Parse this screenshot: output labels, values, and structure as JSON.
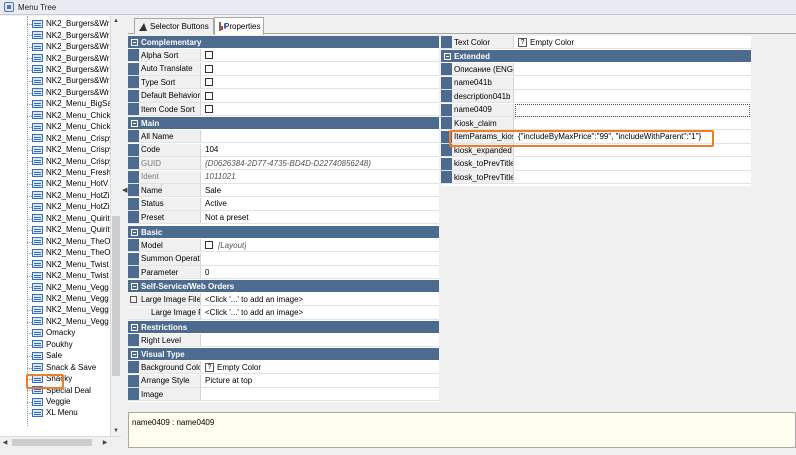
{
  "window": {
    "title": "Menu Tree"
  },
  "tree": {
    "items": [
      "NK2_Burgers&Wr",
      "NK2_Burgers&Wr",
      "NK2_Burgers&Wr",
      "NK2_Burgers&Wr",
      "NK2_Burgers&Wr",
      "NK2_Burgers&Wr",
      "NK2_Burgers&Wr",
      "NK2_Menu_BigSa",
      "NK2_Menu_Chick",
      "NK2_Menu_Chick",
      "NK2_Menu_Crispy",
      "NK2_Menu_Crispy",
      "NK2_Menu_Crispy",
      "NK2_Menu_Fresh",
      "NK2_Menu_HotV",
      "NK2_Menu_HotZi",
      "NK2_Menu_HotZi",
      "NK2_Menu_Quirit",
      "NK2_Menu_Quirit",
      "NK2_Menu_TheO",
      "NK2_Menu_TheO",
      "NK2_Menu_Twist",
      "NK2_Menu_Twist",
      "NK2_Menu_Vegg",
      "NK2_Menu_Vegg",
      "NK2_Menu_Vegg",
      "NK2_Menu_Vegg",
      "Omacky",
      "Poukhy",
      "Sale",
      "Snack & Save",
      "Snacky",
      "Special Deal",
      "Veggie",
      "XL Menu"
    ],
    "selected": "Sale"
  },
  "tabs": [
    {
      "label": "Selector Buttons"
    },
    {
      "label": "Properties"
    }
  ],
  "left_grid": {
    "complementary": {
      "title": "Complementary",
      "rows": [
        "Alpha Sort",
        "Auto Translate",
        "Type Sort",
        "Default Behavior",
        "Item Code Sort"
      ]
    },
    "main": {
      "title": "Main",
      "rows": [
        {
          "name": "All Name",
          "value": ""
        },
        {
          "name": "Code",
          "value": "104"
        },
        {
          "name": "GUID",
          "value": "{D0626384-2D77-4735-BD4D-D22740856248}"
        },
        {
          "name": "Ident",
          "value": "1011021"
        },
        {
          "name": "Name",
          "value": "Sale"
        },
        {
          "name": "Status",
          "value": "Active"
        },
        {
          "name": "Preset",
          "value": "Not a preset"
        }
      ]
    },
    "basic": {
      "title": "Basic",
      "rows": [
        {
          "name": "Model",
          "value": "[Layout]"
        },
        {
          "name": "Summon Operati",
          "value": ""
        },
        {
          "name": "Parameter",
          "value": "0"
        }
      ]
    },
    "self_service": {
      "title": "Self-Service/Web Orders",
      "rows": [
        {
          "name": "Large Image File",
          "value": "<Click '...' to add an image>"
        },
        {
          "name": "Large Image F",
          "value": "<Click '...' to add an image>"
        }
      ]
    },
    "restrictions": {
      "title": "Restrictions",
      "rows": [
        {
          "name": "Right Level",
          "value": ""
        }
      ]
    },
    "visual_type": {
      "title": "Visual Type",
      "rows": [
        {
          "name": "Background Colo",
          "value": "Empty Color"
        },
        {
          "name": "Arrange Style",
          "value": "Picture at top"
        },
        {
          "name": "Image",
          "value": ""
        }
      ]
    }
  },
  "right_grid": {
    "text_color": {
      "name": "Text Color",
      "value": "Empty Color"
    },
    "extended": {
      "title": "Extended",
      "rows": [
        {
          "name": "Описание (ENG",
          "value": ""
        },
        {
          "name": "name041b",
          "value": ""
        },
        {
          "name": "description041b",
          "value": ""
        },
        {
          "name": "name0409",
          "value": ""
        },
        {
          "name": "Kiosk_claim",
          "value": ""
        },
        {
          "name": "ItemParams_kios",
          "value": "{\"includeByMaxPrice\":\"99\", \"includeWithParent\":\"1\"}"
        },
        {
          "name": "kiosk_expanded",
          "value": ""
        },
        {
          "name": "kiosk_toPrevTitle",
          "value": ""
        },
        {
          "name": "kiosk_toPrevTitle",
          "value": ""
        }
      ]
    }
  },
  "description": {
    "text": "name0409 : name0409"
  },
  "icons": {
    "window": "app-icon",
    "tree_node": "menu-node-icon",
    "tab_selector": "cursor-icon",
    "tab_properties": "properties-icon"
  },
  "colors": {
    "category_header": "#4c6b8e",
    "highlight": "#f07d2a",
    "description_bg": "#fffff0"
  }
}
